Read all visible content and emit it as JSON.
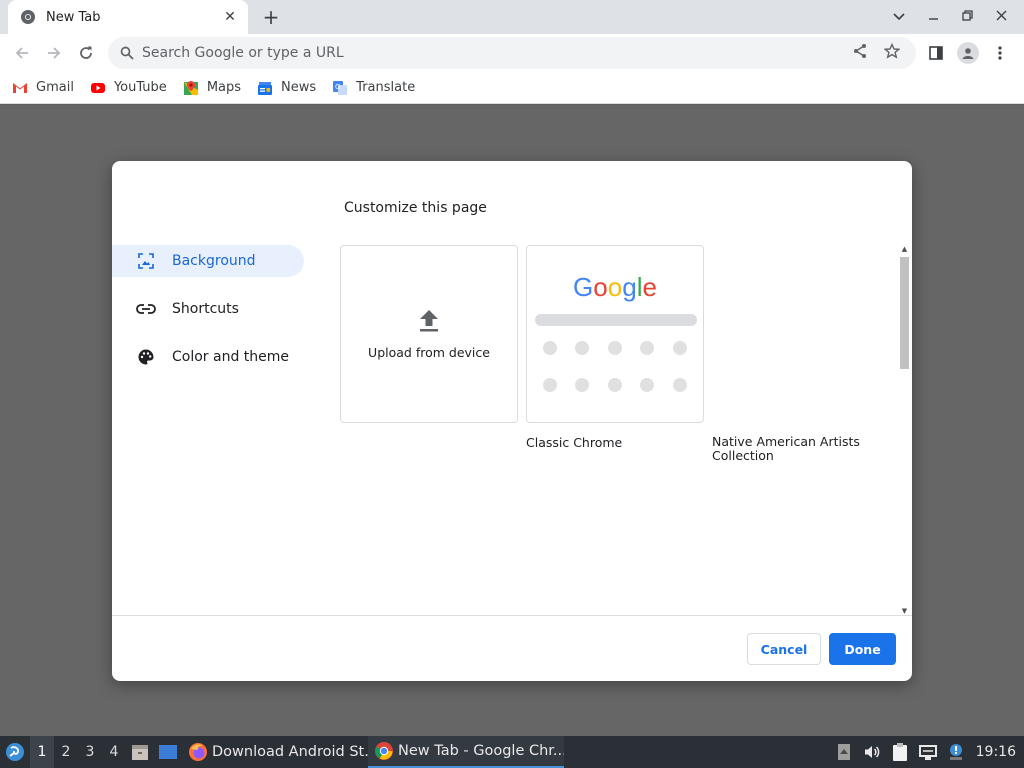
{
  "tab": {
    "title": "New Tab",
    "close": "✕",
    "new_tab": "+"
  },
  "window": {
    "minimize": "—",
    "restore": "❐",
    "close": "✕",
    "tabsearch": "⌄"
  },
  "toolbar": {
    "placeholder": "Search Google or type a URL"
  },
  "bookmarks": [
    "Gmail",
    "YouTube",
    "Maps",
    "News",
    "Translate"
  ],
  "dialog": {
    "title": "Customize this page",
    "menu": [
      "Background",
      "Shortcuts",
      "Color and theme"
    ],
    "tiles": {
      "upload": "Upload from device",
      "classic": "Classic Chrome",
      "collection": "Native American Artists Collection",
      "logo": [
        "G",
        "o",
        "o",
        "g",
        "l",
        "e"
      ]
    },
    "cancel": "Cancel",
    "done": "Done"
  },
  "taskbar": {
    "workspaces": [
      "1",
      "2",
      "3",
      "4"
    ],
    "tasks": [
      "Download Android St...",
      "New Tab - Google Chr..."
    ],
    "clock": "19:16"
  },
  "colors": {
    "accent": "#1a73e8",
    "menu_active_bg": "#e8f0fe",
    "google_blue": "#4285f4",
    "google_red": "#ea4335",
    "google_yellow": "#fbbc05",
    "google_green": "#34a853"
  }
}
